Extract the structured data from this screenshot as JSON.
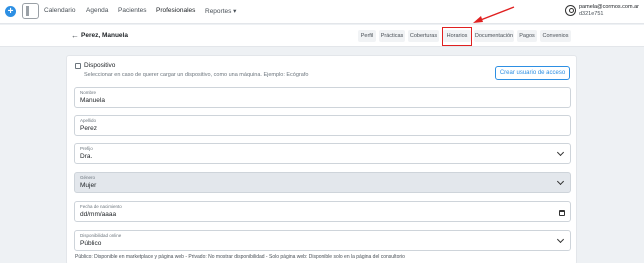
{
  "topbar": {
    "nav": [
      {
        "label": "Calendario",
        "active": false
      },
      {
        "label": "Agenda",
        "active": false
      },
      {
        "label": "Pacientes",
        "active": false
      },
      {
        "label": "Profesionales",
        "active": true
      },
      {
        "label": "Reportes ▾",
        "active": false
      }
    ],
    "user_email": "pamela@cormos.com.ar",
    "user_id": "d321e751",
    "icons": {
      "plus": "plus-icon",
      "sidebar": "sidebar-toggle-icon",
      "user": "user-circle-icon"
    }
  },
  "subheader": {
    "title": "Perez, Manuela",
    "tabs": [
      "Perfil",
      "Prácticas",
      "Coberturas",
      "Horarios",
      "Documentación",
      "Pagos",
      "Convenios"
    ],
    "highlighted_tab": "Horarios",
    "highlight_color": "#e02020"
  },
  "form": {
    "device_label": "Dispositivo",
    "device_help": "Seleccionar en caso de querer cargar un dispositivo, como una máquina. Ejemplo: Ecógrafo",
    "create_user_button": "Crear usuario de acceso",
    "fields": {
      "nombre": {
        "label": "Nombre",
        "value": "Manuela"
      },
      "apellido": {
        "label": "Apellido",
        "value": "Perez"
      },
      "prefijo": {
        "label": "Prefijo",
        "value": "Dra."
      },
      "genero": {
        "label": "Género",
        "value": "Mujer"
      },
      "fecha": {
        "label": "Fecha de nacimiento",
        "value": "dd/mm/aaaa"
      },
      "disponibilidad": {
        "label": "Disponibilidad online",
        "value": "Público"
      }
    },
    "footnote": "Público: Disponible en marketplace y página web - Privado: No mostrar disponibilidad - Solo página web: Disponible solo en la página del consultorio"
  },
  "colors": {
    "accent": "#2d8fe3",
    "annotation": "#e02020"
  }
}
